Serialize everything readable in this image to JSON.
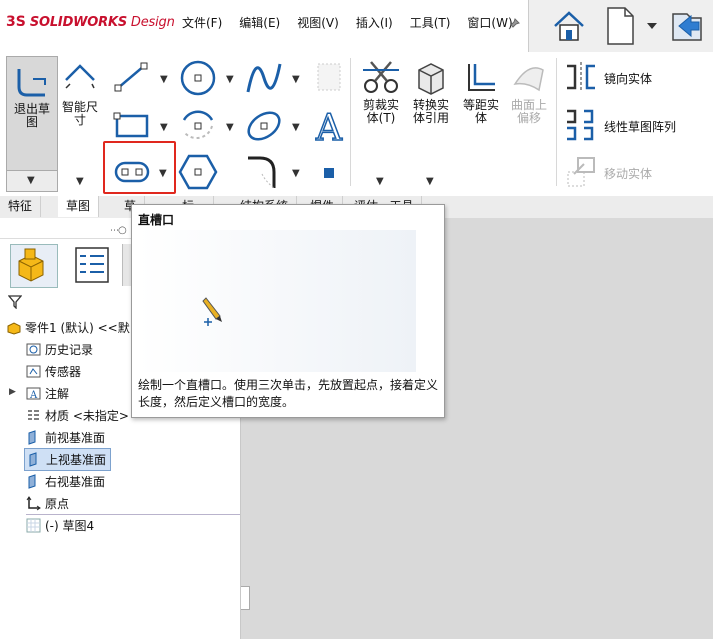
{
  "app": {
    "logo_prefix": "3S",
    "logo_brand": "SOLIDWORKS",
    "logo_suffix": " Design"
  },
  "menu": [
    "文件(F)",
    "编辑(E)",
    "视图(V)",
    "插入(I)",
    "工具(T)",
    "窗口(W)"
  ],
  "ribbon": {
    "exit_sketch": "退出草图",
    "smart_dimension": "智能尺寸",
    "trim": "剪裁实体(T)",
    "convert": "转换实体引用",
    "offset": "等距实体",
    "offset_surface": "曲面上偏移",
    "mirror": "镜向实体",
    "linear_pattern": "线性草图阵列",
    "move": "移动实体"
  },
  "tabs": [
    "特征",
    "草图",
    "草",
    "标...",
    "结构系统",
    "焊件",
    "评估...工具"
  ],
  "tooltip": {
    "title": "直槽口",
    "description": "绘制一个直槽口。使用三次单击，先放置起点，接着定义长度，然后定义槽口的宽度。"
  },
  "tree": {
    "part": "零件1 (默认) <<默",
    "items": [
      "历史记录",
      "传感器",
      "注解",
      "材质 <未指定>",
      "前视基准面",
      "上视基准面",
      "右视基准面",
      "原点",
      "(-) 草图4"
    ]
  },
  "colors": {
    "accent": "#1b5fa8",
    "highlight": "#e0281e",
    "brand": "#c8102e"
  }
}
